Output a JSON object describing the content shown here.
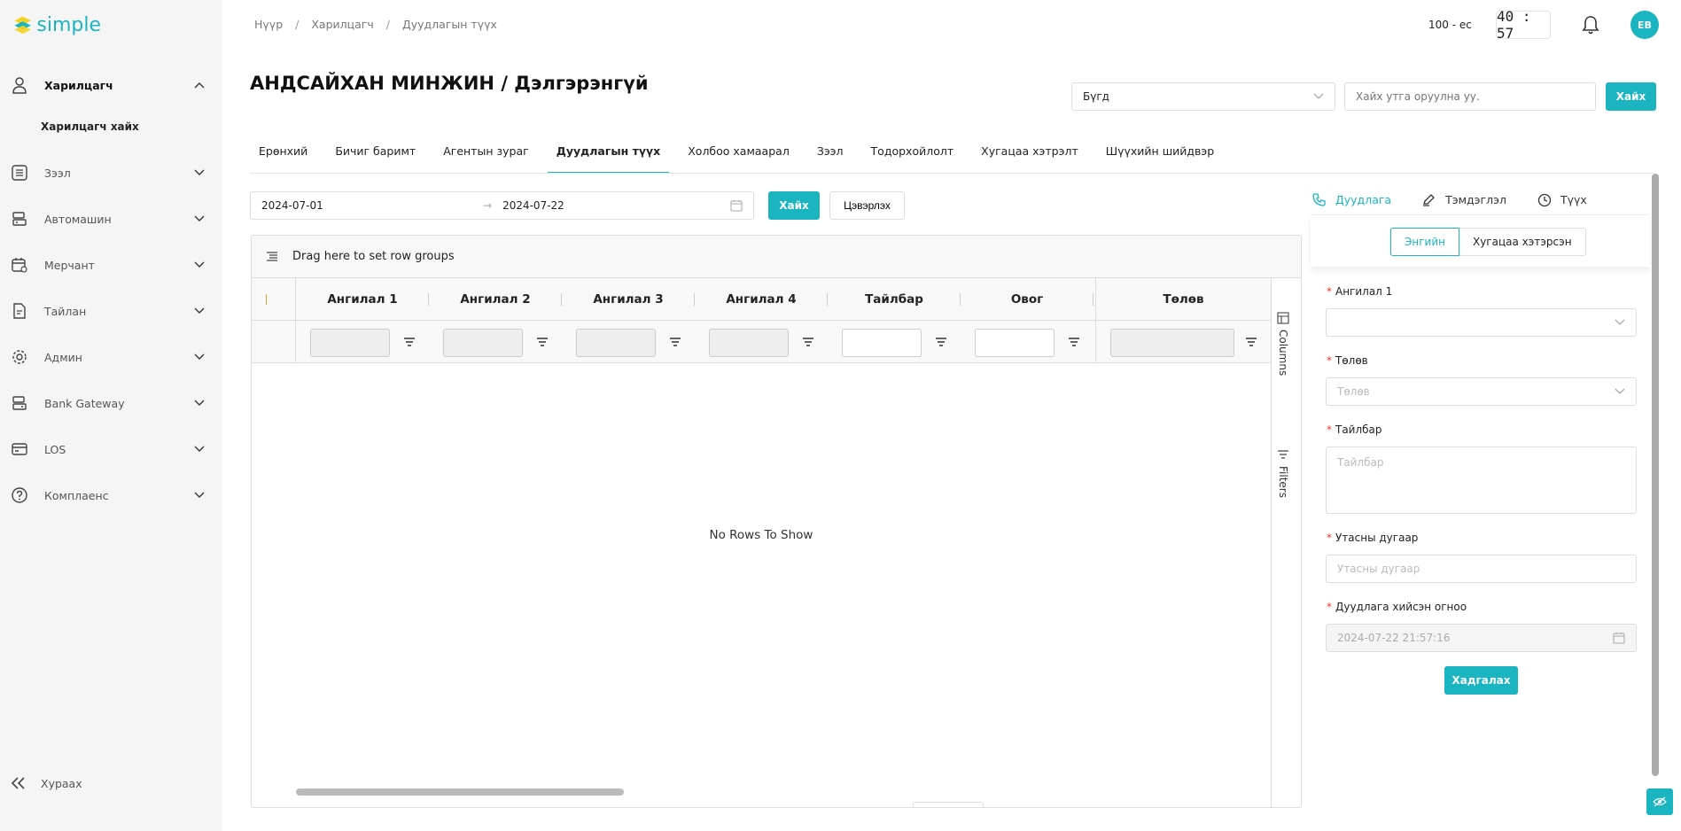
{
  "app": {
    "logo_text": "simple",
    "accent": "#1bb5c1"
  },
  "sidebar": {
    "items": [
      {
        "label": "Харилцагч",
        "icon": "user-icon",
        "active": true
      },
      {
        "label": "Зээл",
        "icon": "list-icon"
      },
      {
        "label": "Автомашин",
        "icon": "car-icon"
      },
      {
        "label": "Мерчант",
        "icon": "calendar-icon"
      },
      {
        "label": "Тайлан",
        "icon": "report-icon"
      },
      {
        "label": "Админ",
        "icon": "gear-icon"
      },
      {
        "label": "Bank Gateway",
        "icon": "bank-icon"
      },
      {
        "label": "LOS",
        "icon": "card-icon"
      },
      {
        "label": "Комплаенс",
        "icon": "help-icon"
      }
    ],
    "sub_item": "Харилцагч хайх",
    "collapse_label": "Хураах"
  },
  "header": {
    "breadcrumb": [
      "Нүүр",
      "Харилцагч",
      "Дуудлагын түүх"
    ],
    "user_code": "100 - ес",
    "timer": "40 : 57",
    "avatar": "EB"
  },
  "page": {
    "title": "АНДСАЙХАН МИНЖИН / Дэлгэрэнгүй",
    "filter_select": "Бүгд",
    "search_placeholder": "Хайх утга оруулна уу.",
    "search_button": "Хайх"
  },
  "tabs": [
    {
      "label": "Ерөнхий"
    },
    {
      "label": "Бичиг баримт"
    },
    {
      "label": "Агентын зураг"
    },
    {
      "label": "Дуудлагын түүх",
      "active": true
    },
    {
      "label": "Холбоо хамаарал"
    },
    {
      "label": "Зээл"
    },
    {
      "label": "Тодорхойлолт"
    },
    {
      "label": "Хугацаа хэтрэлт"
    },
    {
      "label": "Шүүхийн шийдвэр"
    }
  ],
  "date_filter": {
    "from": "2024-07-01",
    "to": "2024-07-22",
    "find_button": "Хайх",
    "clear_button": "Цэвэрлэх"
  },
  "grid": {
    "group_bar_text": "Drag here to set row groups",
    "columns": [
      "Ангилал 1",
      "Ангилал 2",
      "Ангилал 3",
      "Ангилал 4",
      "Тайлбар",
      "Овог",
      "Төлөв"
    ],
    "no_rows": "No Rows To Show",
    "side_columns": "Columns",
    "side_filters": "Filters"
  },
  "right_panel": {
    "tabs": [
      {
        "label": "Дуудлага",
        "icon": "phone-icon",
        "active": true
      },
      {
        "label": "Тэмдэглэл",
        "icon": "pen-icon"
      },
      {
        "label": "Түүх",
        "icon": "history-icon"
      }
    ],
    "segments": [
      "Энгийн",
      "Хугацаа хэтэрсэн"
    ],
    "fields": {
      "category1_label": "Ангилал 1",
      "status_label": "Төлөв",
      "status_placeholder": "Төлөв",
      "desc_label": "Тайлбар",
      "desc_placeholder": "Тайлбар",
      "phone_label": "Утасны дугаар",
      "phone_placeholder": "Утасны дугаар",
      "date_label": "Дуудлага хийсэн огноо",
      "date_value": "2024-07-22 21:57:16"
    },
    "save_button": "Хадгалах"
  }
}
